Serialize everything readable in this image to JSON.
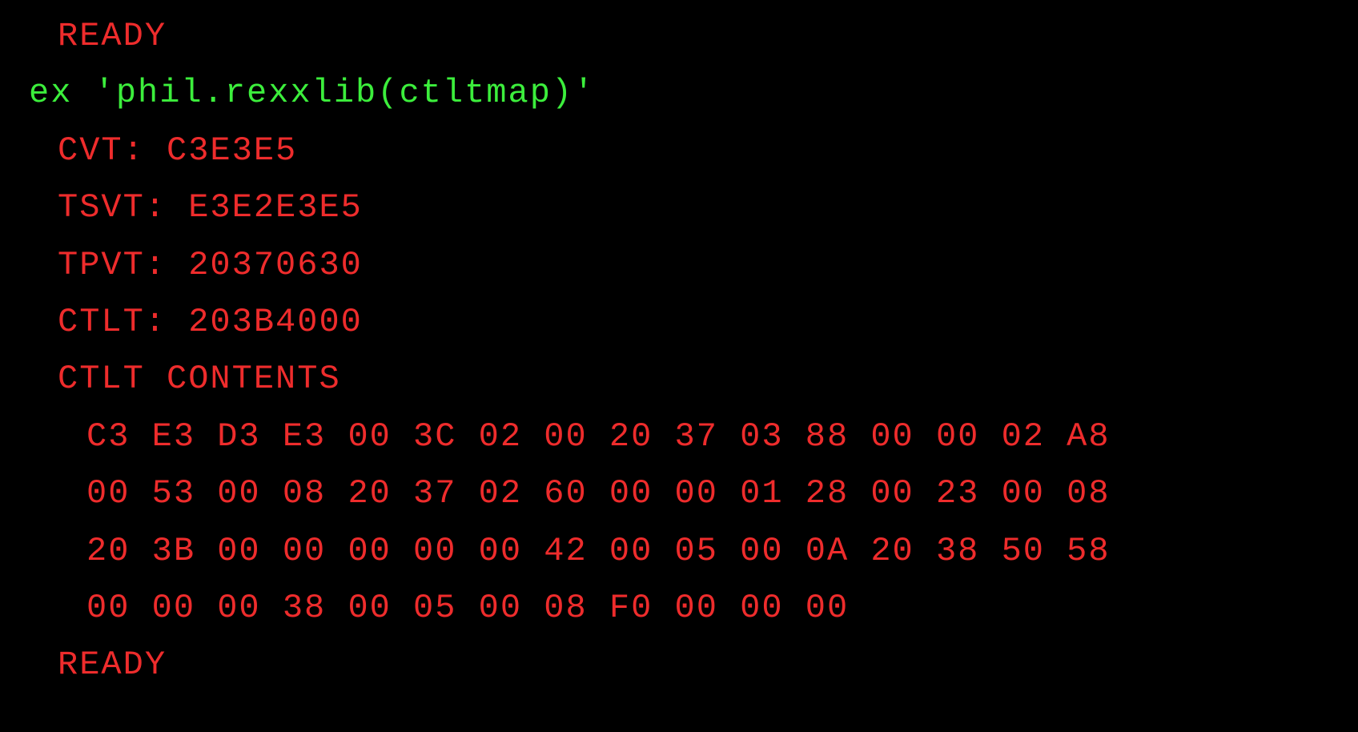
{
  "terminal": {
    "ready1": "READY",
    "command": "ex 'phil.rexxlib(ctltmap)'",
    "cvt": "CVT: C3E3E5",
    "tsvt": "TSVT: E3E2E3E5",
    "tpvt": "TPVT: 20370630",
    "ctlt": "CTLT: 203B4000",
    "contents_header": "CTLT CONTENTS",
    "hexrows": [
      "C3 E3 D3 E3 00 3C 02 00 20 37 03 88 00 00 02 A8",
      "00 53 00 08 20 37 02 60 00 00 01 28 00 23 00 08",
      "20 3B 00 00 00 00 00 42 00 05 00 0A 20 38 50 58",
      "00 00 00 38 00 05 00 08 F0 00 00 00"
    ],
    "ready2": "READY"
  }
}
